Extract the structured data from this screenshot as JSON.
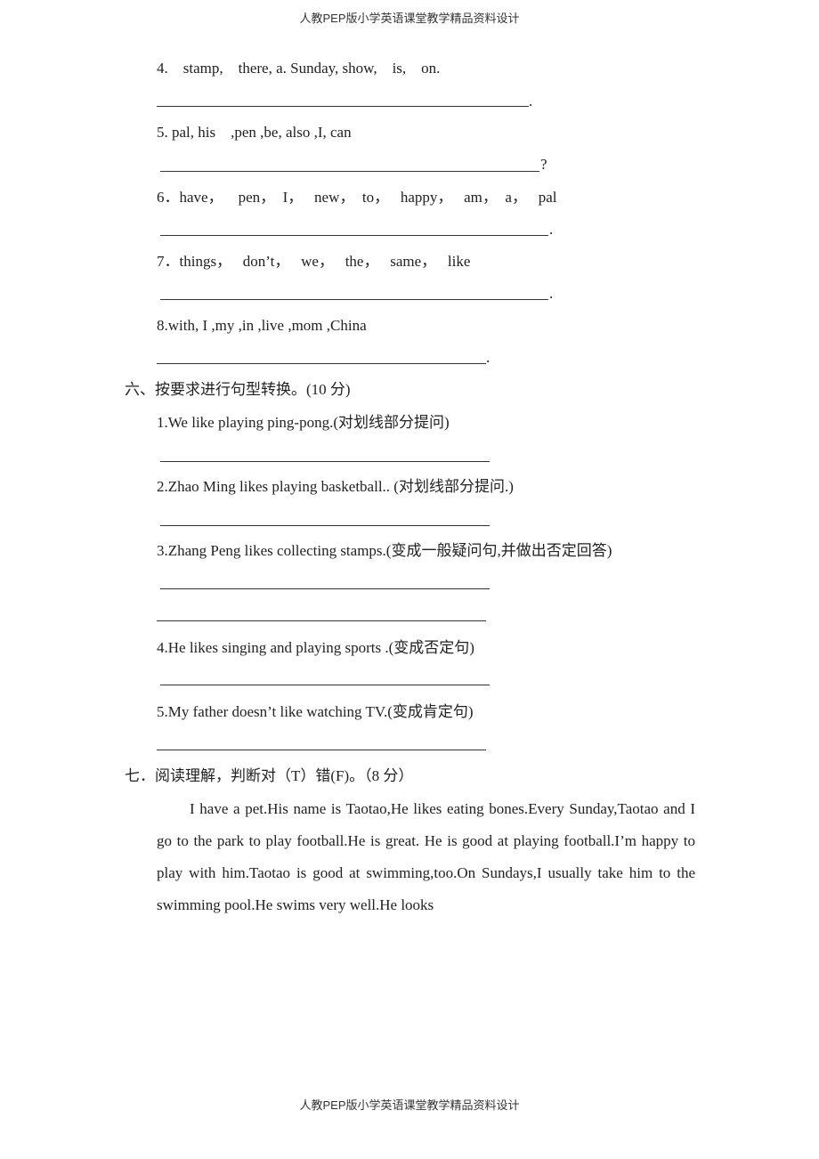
{
  "header": "人教PEP版小学英语课堂教学精品资料设计",
  "footer": "人教PEP版小学英语课堂教学精品资料设计",
  "section5_items": [
    {
      "text": "4.    stamp,    there, a. Sunday, show,    is,    on.",
      "end": "."
    },
    {
      "text": "5. pal, his    ,pen ,be, also ,I, can",
      "end": "?"
    },
    {
      "text": "6．have，    pen，  I，   new，  to，   happy，   am，  a，   pal",
      "end": "."
    },
    {
      "text": "7．things，   don’t，   we，   the，   same，   like",
      "end": "."
    },
    {
      "text": "8.with, I ,my ,in ,live ,mom ,China",
      "end": "."
    }
  ],
  "section6": {
    "title": "六、按要求进行句型转换。(10 分)",
    "items": [
      "1.We like playing ping-pong.(对划线部分提问)",
      "2.Zhao Ming likes playing basketball.. (对划线部分提问.)",
      "3.Zhang Peng likes collecting stamps.(变成一般疑问句,并做出否定回答)",
      "4.He likes singing and playing sports .(变成否定句)",
      "5.My father doesn’t like watching TV.(变成肯定句)"
    ]
  },
  "section7": {
    "title": "七．阅读理解，判断对（T）错(F)。（8 分）",
    "passage": "I have a pet.His name is Taotao,He likes eating bones.Every Sunday,Taotao and I go to the park to play football.He is great. He is good at playing football.I’m happy to play with him.Taotao is good at swimming,too.On Sundays,I usually take him to the swimming pool.He swims very well.He looks"
  }
}
